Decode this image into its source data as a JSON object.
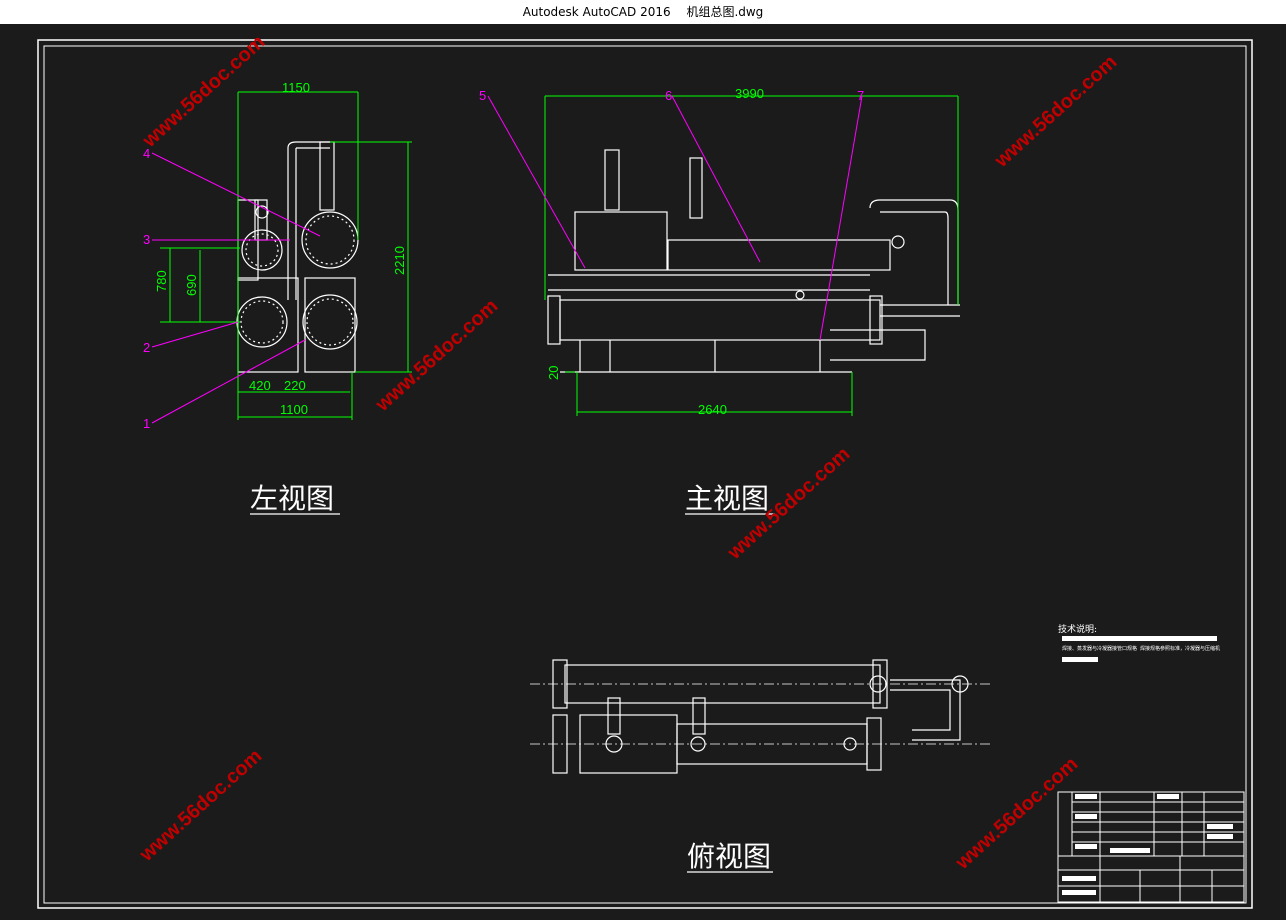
{
  "window": {
    "app_name": "Autodesk AutoCAD 2016",
    "file_name": "机组总图.dwg"
  },
  "views": {
    "left": "左视图",
    "front": "主视图",
    "top": "俯视图"
  },
  "dimensions": {
    "left_width_top": "1150",
    "left_height": "2210",
    "left_780": "780",
    "left_690": "690",
    "left_420": "420",
    "left_220": "220",
    "left_width_bottom": "1100",
    "front_length": "3990",
    "front_base": "2640",
    "front_20": "20"
  },
  "callouts": {
    "c1": "1",
    "c2": "2",
    "c3": "3",
    "c4": "4",
    "c5": "5",
    "c6": "6",
    "c7": "7"
  },
  "notes": {
    "heading": "技术说明:",
    "line": "焊接、蒸发器与冷凝器接管口规格",
    "line2": "焊接规格参照标准，冷凝器与压缩机"
  },
  "watermark": "www.56doc.com",
  "colors": {
    "background": "#1b1b1b",
    "drawing": "#ffffff",
    "dimension": "#00ff00",
    "leader": "#ff00ff",
    "watermark": "#c00000"
  }
}
